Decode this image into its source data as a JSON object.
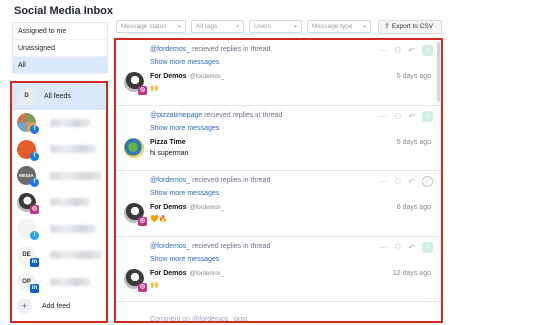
{
  "title": "Social Media Inbox",
  "filters": [
    "Assigned to me",
    "Unassigned",
    "All"
  ],
  "feeds": {
    "all_label": "All feeds",
    "all_avatar_text": "D",
    "rows": [
      {
        "avatar": "av-multi",
        "badge": "fb",
        "badge_glyph": "f",
        "avatar_text": ""
      },
      {
        "avatar": "av-orange",
        "badge": "fb",
        "badge_glyph": "f",
        "avatar_text": ""
      },
      {
        "avatar": "av-gray",
        "badge": "fb",
        "badge_glyph": "f",
        "avatar_text": "MEDIA"
      },
      {
        "avatar": "av-dark",
        "badge": "ig",
        "badge_glyph": "◎",
        "avatar_text": ""
      },
      {
        "avatar": "av-white",
        "badge": "tw",
        "badge_glyph": "t",
        "avatar_text": ""
      },
      {
        "avatar": "av-white",
        "badge": "li",
        "badge_glyph": "in",
        "avatar_text": "DE"
      },
      {
        "avatar": "av-white",
        "badge": "li",
        "badge_glyph": "in",
        "avatar_text": "OP"
      }
    ],
    "add_label": "Add feed"
  },
  "toolbar": {
    "message_status": "Message status",
    "all_tags": "All tags",
    "users": "Users",
    "message_type": "Message type",
    "export": "Export to CSV"
  },
  "messages": [
    {
      "handle": "@fordemos_",
      "action": " recieved replies in thread",
      "more": "Show more messages",
      "name": "For Demos",
      "sub": "@fordemos_",
      "text": "🙌",
      "time": "5 days ago",
      "avatar": "av-dark",
      "badge": "ig",
      "done": "filled"
    },
    {
      "handle": "@pizzatimepage",
      "action": " recieved replies in thread",
      "more": "Show more messages",
      "name": "Pizza Time",
      "sub": "",
      "text": "hi superman",
      "time": "5 days ago",
      "avatar": "av-pizza",
      "badge": "",
      "done": "filled"
    },
    {
      "handle": "@fordemos_",
      "action": " recieved replies in thread",
      "more": "Show more messages",
      "name": "For Demos",
      "sub": "@fordemos_",
      "text": "🧡🔥",
      "time": "6 days ago",
      "avatar": "av-dark",
      "badge": "ig",
      "done": "outline"
    },
    {
      "handle": "@fordemos_",
      "action": " recieved replies in thread",
      "more": "Show more messages",
      "name": "For Demos",
      "sub": "@fordemos_",
      "text": "🙌",
      "time": "12 days ago",
      "avatar": "av-dark",
      "badge": "ig",
      "done": "filled"
    }
  ],
  "peek_text": "Comment on @fordemos_ post"
}
